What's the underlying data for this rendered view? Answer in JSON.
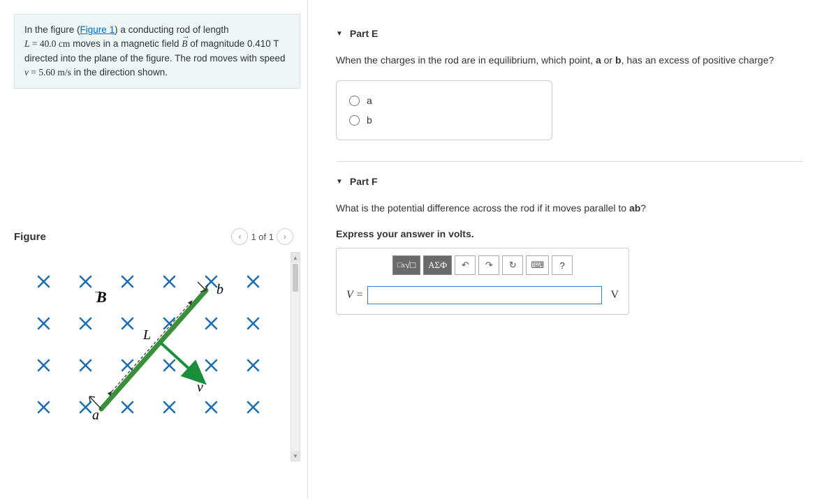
{
  "problem": {
    "intro_prefix": "In the figure (",
    "figure_link": "Figure 1",
    "intro_suffix": ") a conducting rod of length",
    "L_text": "L",
    "L_eq": " = 40.0 cm",
    "moves_text": " moves in a magnetic field ",
    "B_text": "B",
    "mag_text": " of magnitude 0.410 T directed into the plane of the figure. The rod moves with speed ",
    "v_text": "v",
    "v_eq": " = 5.60 m/s",
    "dir_text": " in the direction shown."
  },
  "figure": {
    "title": "Figure",
    "nav_text": "1 of 1",
    "labels": {
      "B": "B",
      "L": "L",
      "a": "a",
      "b": "b",
      "v": "v"
    }
  },
  "partE": {
    "title": "Part E",
    "question": "When the charges in the rod are in equilibrium, which point, a or b, has an excess of positive charge?",
    "options": {
      "a": "a",
      "b": "b"
    }
  },
  "partF": {
    "title": "Part F",
    "question": "What is the potential difference across the rod if it moves parallel to ab?",
    "instruction": "Express your answer in volts.",
    "lhs": "V =",
    "unit": "V",
    "input_value": "",
    "toolbar": {
      "templates": "✕̅√☐",
      "greek": "ΑΣФ",
      "undo": "↶",
      "redo": "↷",
      "reset": "↻",
      "keyboard": "⌨",
      "help": "?"
    }
  }
}
